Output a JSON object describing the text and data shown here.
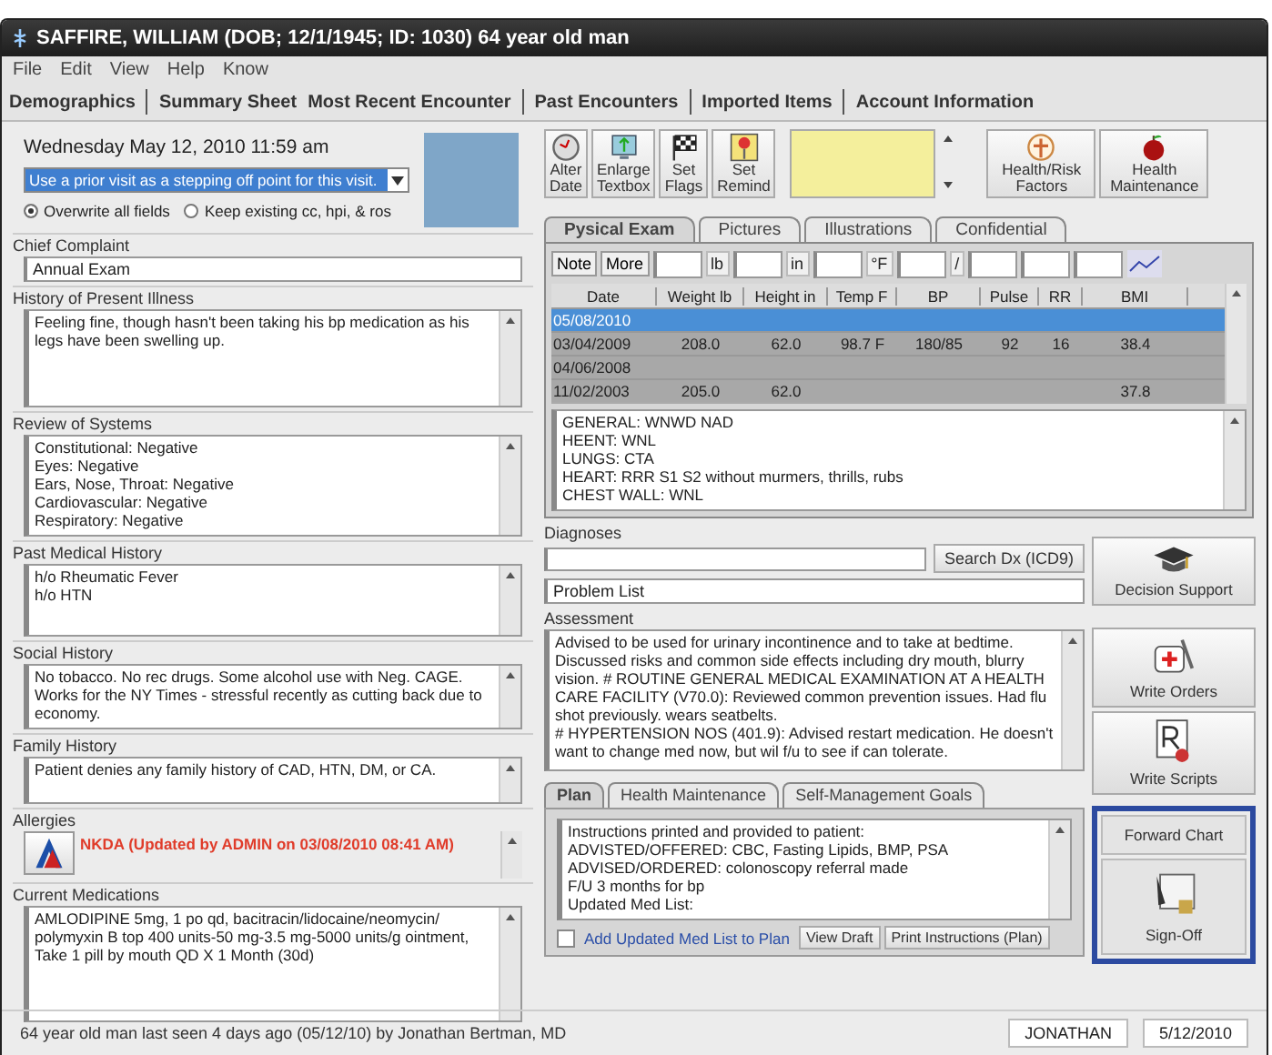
{
  "window": {
    "title": "SAFFIRE, WILLIAM (DOB; 12/1/1945; ID: 1030) 64 year old man"
  },
  "menu": [
    "File",
    "Edit",
    "View",
    "Help",
    "Know"
  ],
  "nav_tabs": [
    "Demographics",
    "Summary Sheet",
    "Most Recent Encounter",
    "Past Encounters",
    "Imported Items",
    "Account Information"
  ],
  "visit": {
    "datetime": "Wednesday May 12, 2010 11:59 am",
    "dropdown_value": "Use a prior visit as a stepping off point for this visit.",
    "options": [
      {
        "label": "Overwrite all fields",
        "selected": true
      },
      {
        "label": "Keep existing cc, hpi, & ros",
        "selected": false
      }
    ]
  },
  "sections": [
    {
      "kind": "field",
      "label": "Chief Complaint",
      "lines": [
        "Annual Exam"
      ]
    },
    {
      "kind": "text",
      "label": "History of Present Illness",
      "lines": [
        "Feeling fine, though hasn't been taking his bp medication as his legs have been swelling up."
      ]
    },
    {
      "kind": "text",
      "label": "Review of Systems",
      "lines": [
        "Constitutional: Negative",
        "Eyes: Negative",
        "Ears, Nose, Throat: Negative",
        "Cardiovascular: Negative",
        "Respiratory: Negative"
      ]
    },
    {
      "kind": "text",
      "label": "Past Medical History",
      "lines": [
        "h/o Rheumatic Fever",
        "h/o HTN"
      ]
    },
    {
      "kind": "text",
      "label": "Social History",
      "lines": [
        "No tobacco. No rec drugs. Some alcohol use with Neg. CAGE. Works for the NY Times - stressful recently as cutting back due to economy."
      ]
    },
    {
      "kind": "text",
      "label": "Family History",
      "lines": [
        "Patient denies any family history of CAD, HTN, DM, or CA."
      ]
    },
    {
      "kind": "allergy",
      "label": "Allergies",
      "lines": [
        "NKDA (Updated by ADMIN on 03/08/2010 08:41 AM)"
      ]
    },
    {
      "kind": "text",
      "label": "Current Medications",
      "lines": [
        "AMLODIPINE 5mg, 1 po qd, bacitracin/lidocaine/neomycin/ polymyxin B top 400 units-50 mg-3.5 mg-5000 units/g ointment, Take 1 pill by mouth QD X 1 Month (30d)"
      ]
    }
  ],
  "toolbar": [
    [
      "Alter",
      "Date"
    ],
    [
      "Enlarge",
      "Textbox"
    ],
    [
      "Set",
      "Flags"
    ],
    [
      "Set",
      "Remind"
    ]
  ],
  "toolbar_right": [
    [
      "Health/Risk",
      "Factors"
    ],
    [
      "Health",
      "Maintenance"
    ]
  ],
  "exam_tabs": [
    {
      "label": "Pysical Exam",
      "selected": true
    },
    {
      "label": "Pictures",
      "selected": false
    },
    {
      "label": "Illustrations",
      "selected": false
    },
    {
      "label": "Confidential",
      "selected": false
    }
  ],
  "vitals_entry": {
    "buttons": [
      "Note",
      "More"
    ],
    "units": [
      "lb",
      "in",
      "°F",
      "/"
    ]
  },
  "vitals": {
    "columns": [
      "Date",
      "Weight lb",
      "Height in",
      "Temp F",
      "BP",
      "Pulse",
      "RR",
      "BMI"
    ],
    "rows": [
      {
        "selected": true,
        "cells": [
          "05/08/2010",
          "",
          "",
          "",
          "",
          "",
          "",
          ""
        ]
      },
      {
        "selected": false,
        "cells": [
          "03/04/2009",
          "208.0",
          "62.0",
          "98.7 F",
          "180/85",
          "92",
          "16",
          "38.4"
        ]
      },
      {
        "selected": false,
        "cells": [
          "04/06/2008",
          "",
          "",
          "",
          "",
          "",
          "",
          ""
        ]
      },
      {
        "selected": false,
        "cells": [
          "11/02/2003",
          "205.0",
          "62.0",
          "",
          "",
          "",
          "",
          "37.8"
        ]
      }
    ]
  },
  "exam_notes": [
    "GENERAL: WNWD NAD",
    "HEENT: WNL",
    "LUNGS: CTA",
    "HEART: RRR S1 S2 without murmers, thrills, rubs",
    "CHEST WALL: WNL"
  ],
  "diagnoses": {
    "label": "Diagnoses",
    "search_button": "Search Dx (ICD9)",
    "problem_list": "Problem List"
  },
  "assessment": {
    "label": "Assessment",
    "lines": [
      "Advised to be used for urinary incontinence and to take at bedtime. Discussed risks and common side effects including dry mouth, blurry vision. # ROUTINE GENERAL MEDICAL EXAMINATION AT A HEALTH CARE FACILITY (V70.0): Reviewed common prevention issues. Had flu shot previously. wears seatbelts.",
      "# HYPERTENSION NOS (401.9): Advised restart medication. He doesn't want to change med now, but wil f/u to see if can tolerate."
    ]
  },
  "plan_tabs": [
    {
      "label": "Plan",
      "selected": true
    },
    {
      "label": "Health Maintenance",
      "selected": false
    },
    {
      "label": "Self-Management Goals",
      "selected": false
    }
  ],
  "plan_lines": [
    "Instructions printed and provided to patient:",
    "ADVISTED/OFFERED: CBC, Fasting Lipids, BMP, PSA",
    "ADVISED/ORDERED: colonoscopy referral made",
    "F/U 3 months for bp",
    "Updated Med List:"
  ],
  "plan_checkbox": {
    "label": "Add Updated Med List to Plan",
    "checked": false
  },
  "plan_buttons": [
    "View Draft",
    "Print Instructions (Plan)"
  ],
  "side_buttons": [
    "Decision Support",
    "Write Orders",
    "Write Scripts"
  ],
  "forward_chart": "Forward Chart",
  "sign_off": "Sign-Off",
  "status_bar": {
    "text": "64 year old man last seen 4 days ago (05/12/10) by Jonathan Bertman, MD",
    "user": "JONATHAN",
    "date": "5/12/2010"
  }
}
